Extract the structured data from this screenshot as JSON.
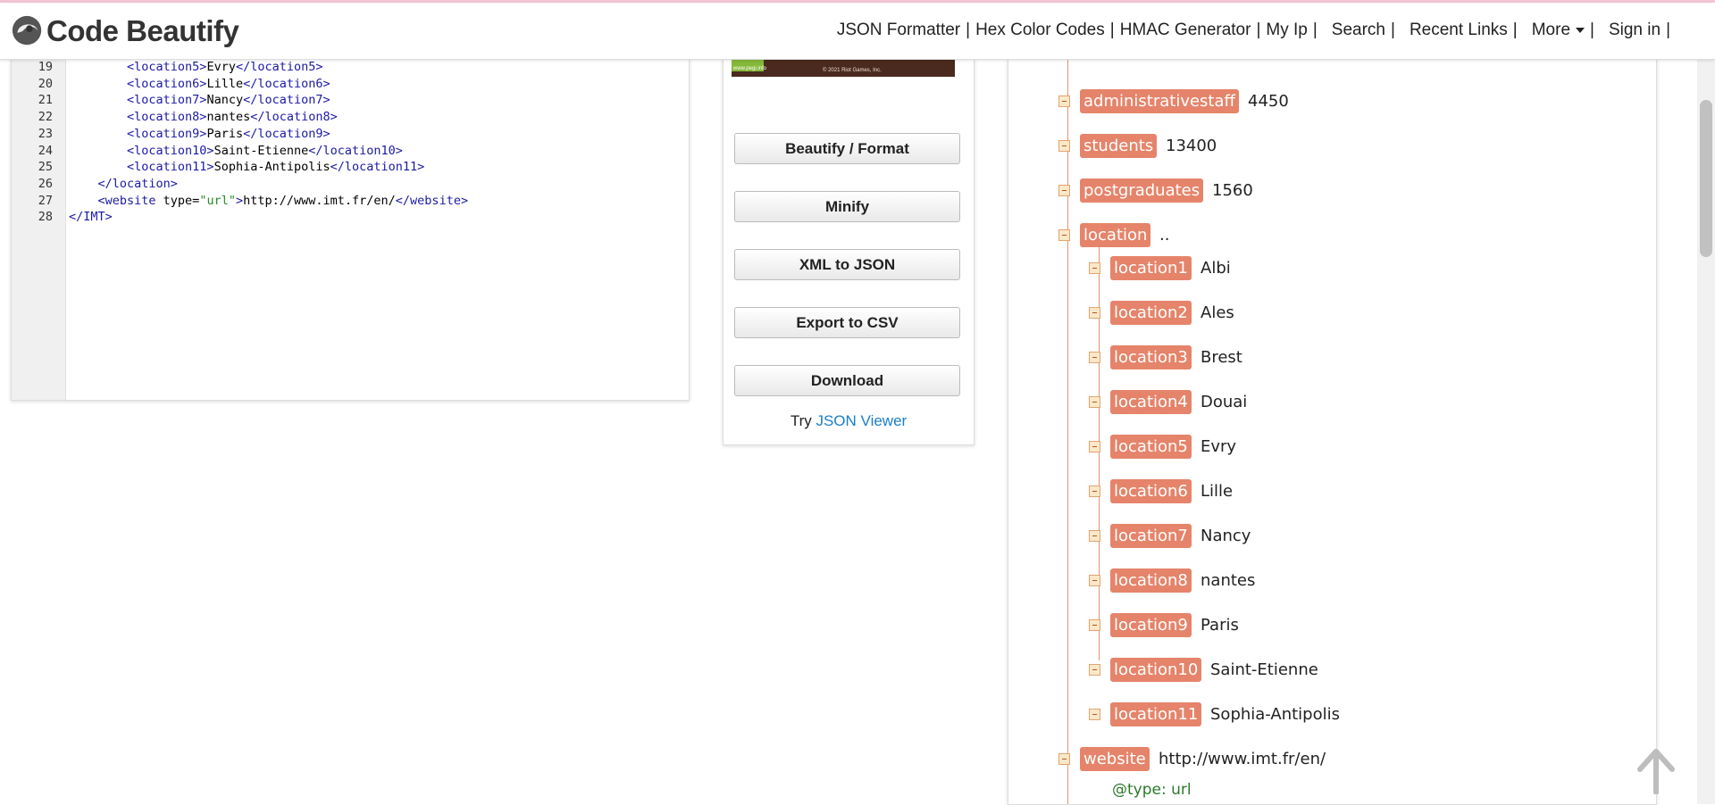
{
  "brand": {
    "name": "Code Beautify"
  },
  "nav": {
    "links": [
      "JSON Formatter",
      "Hex Color Codes",
      "HMAC Generator",
      "My Ip",
      "Search",
      "Recent Links",
      "More",
      "Sign in"
    ]
  },
  "editor": {
    "line_numbers": [
      "19",
      "20",
      "21",
      "22",
      "23",
      "24",
      "25",
      "26",
      "27",
      "28"
    ],
    "lines": [
      {
        "indent": "        ",
        "open": "<location5>",
        "text": "Evry",
        "close": "</location5>"
      },
      {
        "indent": "        ",
        "open": "<location6>",
        "text": "Lille",
        "close": "</location6>"
      },
      {
        "indent": "        ",
        "open": "<location7>",
        "text": "Nancy",
        "close": "</location7>"
      },
      {
        "indent": "        ",
        "open": "<location8>",
        "text": "nantes",
        "close": "</location8>"
      },
      {
        "indent": "        ",
        "open": "<location9>",
        "text": "Paris",
        "close": "</location9>"
      },
      {
        "indent": "        ",
        "open": "<location10>",
        "text": "Saint-Etienne",
        "close": "</location10>"
      },
      {
        "indent": "        ",
        "open": "<location11>",
        "text": "Sophia-Antipolis",
        "close": "</location11>"
      },
      {
        "indent": "    ",
        "open": "</location>",
        "text": "",
        "close": ""
      },
      {
        "indent": "    ",
        "open": "<website",
        "attr": " type=",
        "attr_val": "\"url\"",
        "open_end": ">",
        "text": "http://www.imt.fr/en/",
        "close": "</website>"
      },
      {
        "indent": "",
        "open": "</IMT>",
        "text": "",
        "close": ""
      }
    ]
  },
  "ad": {
    "small_text": "www.pegi.info",
    "copyright": "© 2021 Riot Games, Inc."
  },
  "actions": {
    "beautify": "Beautify / Format",
    "minify": "Minify",
    "xml_to_json": "XML to JSON",
    "export_csv": "Export to CSV",
    "download": "Download",
    "try_prefix": "Try",
    "try_link": "JSON Viewer"
  },
  "tree": {
    "nodes": [
      {
        "key": "administrativestaff",
        "value": "4450"
      },
      {
        "key": "students",
        "value": "13400"
      },
      {
        "key": "postgraduates",
        "value": "1560"
      },
      {
        "key": "location",
        "value": ".."
      },
      {
        "key": "location1",
        "value": "Albi"
      },
      {
        "key": "location2",
        "value": "Ales"
      },
      {
        "key": "location3",
        "value": "Brest"
      },
      {
        "key": "location4",
        "value": "Douai"
      },
      {
        "key": "location5",
        "value": "Evry"
      },
      {
        "key": "location6",
        "value": "Lille"
      },
      {
        "key": "location7",
        "value": "Nancy"
      },
      {
        "key": "location8",
        "value": "nantes"
      },
      {
        "key": "location9",
        "value": "Paris"
      },
      {
        "key": "location10",
        "value": "Saint-Etienne"
      },
      {
        "key": "location11",
        "value": "Sophia-Antipolis"
      },
      {
        "key": "website",
        "value": "http://www.imt.fr/en/"
      }
    ],
    "attribute": {
      "name": "@type:",
      "value": "url"
    }
  },
  "colors": {
    "key_bg": "#e5846a",
    "tree_line": "#e6936e",
    "link": "#1a7ec8"
  }
}
